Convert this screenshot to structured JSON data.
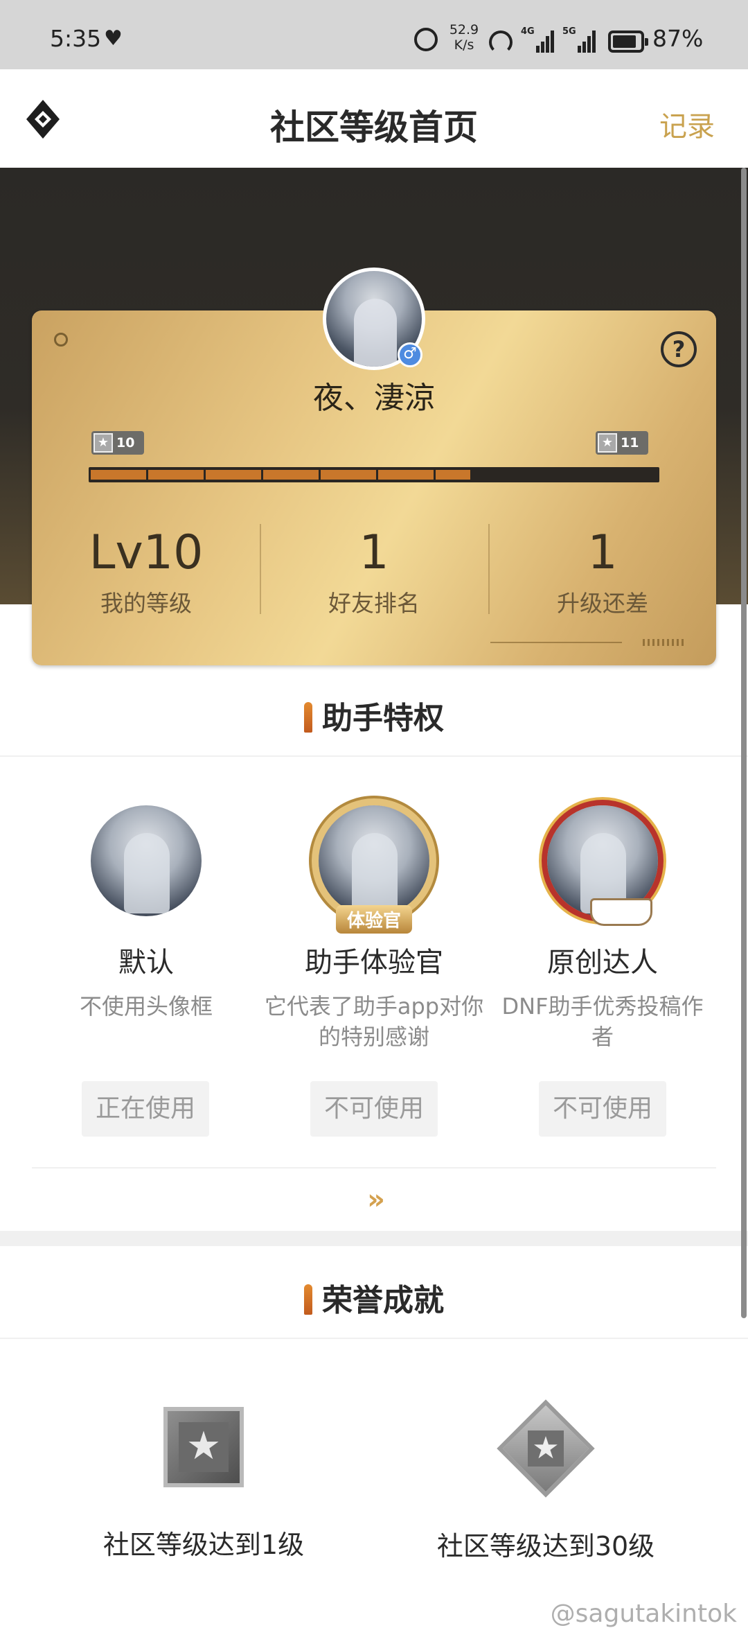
{
  "status_bar": {
    "time": "5:35",
    "net_speed_value": "52.9",
    "net_speed_unit": "K/s",
    "sim1_tag": "4G",
    "sim2_tag": "5G",
    "battery_level": 0.87,
    "battery_text": "87%"
  },
  "header": {
    "title": "社区等级首页",
    "right_link": "记录"
  },
  "profile": {
    "username": "夜、淒涼",
    "gender_symbol": "♂",
    "current_level_badge": "10",
    "next_level_badge": "11",
    "progress": 0.67,
    "stats": [
      {
        "value": "Lv10",
        "label": "我的等级"
      },
      {
        "value": "1",
        "label": "好友排名"
      },
      {
        "value": "1",
        "label": "升级还差"
      }
    ],
    "help_glyph": "?"
  },
  "privileges": {
    "title": "助手特权",
    "items": [
      {
        "name": "默认",
        "desc": "不使用头像框",
        "button": "正在使用"
      },
      {
        "name": "助手体验官",
        "desc": "它代表了助手app对你的特别感谢",
        "button": "不可使用",
        "frame_tag": "体验官"
      },
      {
        "name": "原创达人",
        "desc": "DNF助手优秀投稿作者",
        "button": "不可使用"
      }
    ],
    "more": "»"
  },
  "honors": {
    "title": "荣誉成就",
    "items": [
      {
        "label": "社区等级达到1级",
        "icon": "silver-square-star-badge"
      },
      {
        "label": "社区等级达到30级",
        "icon": "silver-diamond-star-badge"
      }
    ]
  },
  "watermark": "@sagutakintok",
  "colors": {
    "accent_gold": "#c9a24f",
    "progress_orange": "#c9772b",
    "card_gold": "#e6c582"
  }
}
